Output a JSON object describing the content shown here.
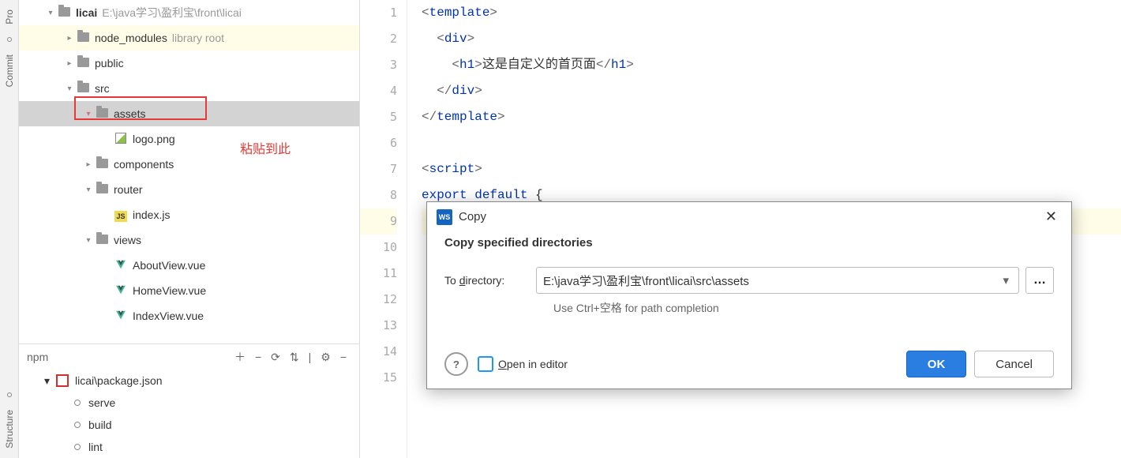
{
  "rail": {
    "project_label": "Pro",
    "commit_label": "Commit",
    "structure_label": "Structure"
  },
  "tree": {
    "root": {
      "name": "licai",
      "path": "E:\\java学习\\盈利宝\\front\\licai"
    },
    "node_modules_label": "node_modules",
    "node_modules_hint": "library root",
    "public_label": "public",
    "src_label": "src",
    "assets_label": "assets",
    "logo_label": "logo.png",
    "components_label": "components",
    "router_label": "router",
    "index_js_label": "index.js",
    "views_label": "views",
    "about_view_label": "AboutView.vue",
    "home_view_label": "HomeView.vue",
    "index_view_label": "IndexView.vue"
  },
  "annotation": "粘贴到此",
  "npm": {
    "title": "npm",
    "file": "licai\\package.json",
    "scripts": {
      "serve": "serve",
      "build": "build",
      "lint": "lint"
    }
  },
  "code": {
    "lines": [
      "1",
      "2",
      "3",
      "4",
      "5",
      "6",
      "7",
      "8",
      "9",
      "10",
      "11",
      "12",
      "13",
      "14",
      "15"
    ],
    "l1": "<template>",
    "l2": "  <div>",
    "l3": "    <h1>这是自定义的首页面</h1>",
    "l4": "  </div>",
    "l5": "</template>",
    "l6": "",
    "l7": "<script>",
    "l8": "export default {",
    "l10": "",
    "l11": "",
    "l12": "",
    "l13": "",
    "l14": "",
    "l15": ""
  },
  "dialog": {
    "title": "Copy",
    "heading": "Copy specified directories",
    "to_dir_label": "To directory:",
    "to_dir_underline": "d",
    "path": "E:\\java学习\\盈利宝\\front\\licai\\src\\assets",
    "hint": "Use Ctrl+空格 for path completion",
    "open_label": "Open in editor",
    "open_underline": "O",
    "ok": "OK",
    "cancel": "Cancel"
  }
}
